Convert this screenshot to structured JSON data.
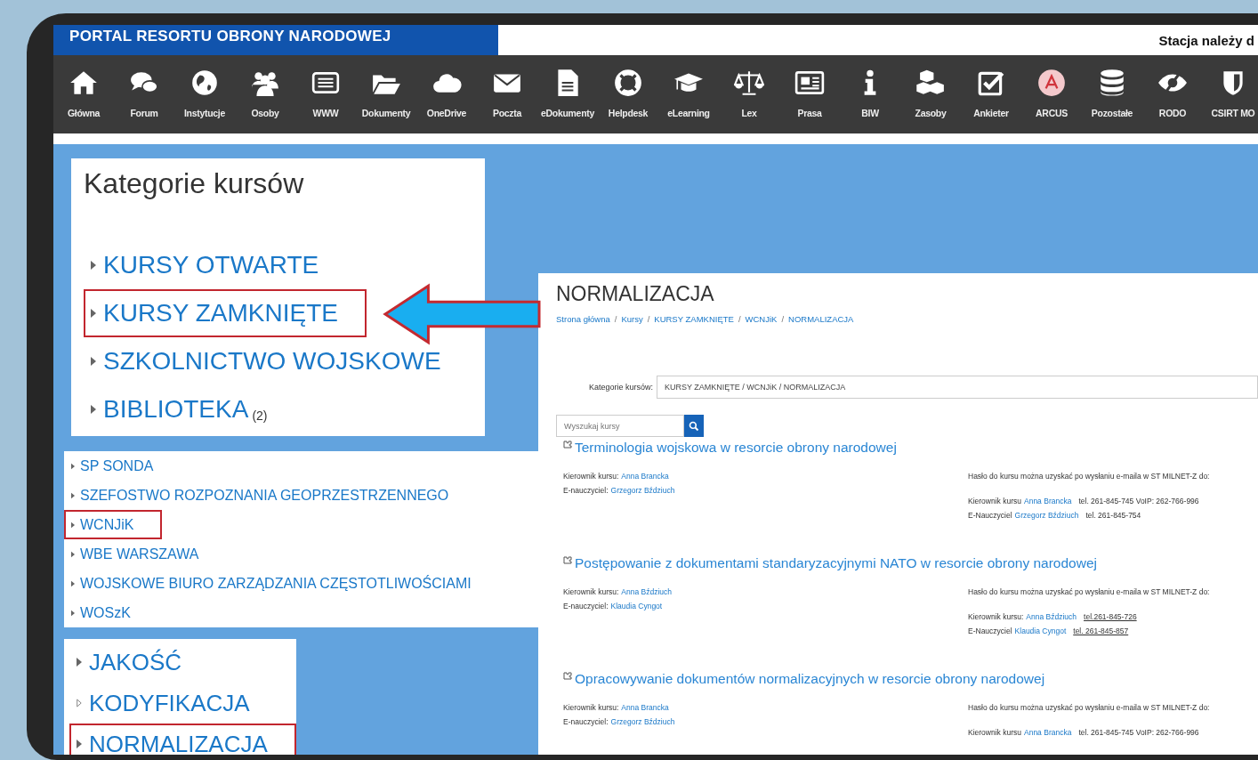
{
  "header": {
    "title": "PORTAL RESORTU OBRONY NARODOWEJ",
    "notice": "Stacja należy d"
  },
  "toolbar": [
    {
      "label": "Główna"
    },
    {
      "label": "Forum"
    },
    {
      "label": "Instytucje"
    },
    {
      "label": "Osoby"
    },
    {
      "label": "WWW"
    },
    {
      "label": "Dokumenty"
    },
    {
      "label": "OneDrive"
    },
    {
      "label": "Poczta"
    },
    {
      "label": "eDokumenty"
    },
    {
      "label": "Helpdesk"
    },
    {
      "label": "eLearning"
    },
    {
      "label": "Lex"
    },
    {
      "label": "Prasa"
    },
    {
      "label": "BIW"
    },
    {
      "label": "Zasoby"
    },
    {
      "label": "Ankieter"
    },
    {
      "label": "ARCUS"
    },
    {
      "label": "Pozostałe"
    },
    {
      "label": "RODO"
    },
    {
      "label": "CSIRT MO"
    }
  ],
  "categories_panel": {
    "title": "Kategorie kursów",
    "items": [
      {
        "label": "KURSY OTWARTE",
        "highlighted": false
      },
      {
        "label": "KURSY ZAMKNIĘTE",
        "highlighted": true
      },
      {
        "label": "SZKOLNICTWO WOJSKOWE",
        "highlighted": false
      },
      {
        "label": "BIBLIOTEKA",
        "count": "(2)",
        "highlighted": false
      }
    ]
  },
  "subcategories": [
    {
      "label": "SP SONDA",
      "highlighted": false
    },
    {
      "label": "SZEFOSTWO ROZPOZNANIA GEOPRZESTRZENNEGO",
      "highlighted": false
    },
    {
      "label": "WCNJiK",
      "highlighted": true
    },
    {
      "label": "WBE WARSZAWA",
      "highlighted": false
    },
    {
      "label": "WOJSKOWE BIURO ZARZĄDZANIA CZĘSTOTLIWOŚCIAMI",
      "highlighted": false
    },
    {
      "label": "WOSzK",
      "highlighted": false
    }
  ],
  "sections": [
    {
      "label": "JAKOŚĆ",
      "kind": "filled",
      "highlighted": false
    },
    {
      "label": "KODYFIKACJA",
      "kind": "hollow",
      "highlighted": false
    },
    {
      "label": "NORMALIZACJA",
      "kind": "filled",
      "highlighted": true
    }
  ],
  "page": {
    "title": "NORMALIZACJA",
    "breadcrumb_separator": "/",
    "breadcrumb": [
      "Strona główna",
      "Kursy",
      "KURSY ZAMKNIĘTE",
      "WCNJiK",
      "NORMALIZACJA"
    ],
    "category_label": "Kategorie kursów:",
    "category_value": "KURSY ZAMKNIĘTE / WCNJiK / NORMALIZACJA",
    "search": {
      "placeholder": "Wyszukaj kursy"
    },
    "courses": [
      {
        "title": "Terminologia wojskowa w resorcie obrony narodowej",
        "left": [
          {
            "label": "Kierownik kursu:",
            "person": "Anna Brancka"
          },
          {
            "label": "E-nauczyciel:",
            "person": "Grzegorz Bździuch"
          }
        ],
        "note": "Hasło do kursu można uzyskać po wysłaniu e-maila w ST MILNET-Z do:",
        "right": [
          {
            "label": "Kierownik kursu",
            "person": "Anna Brancka",
            "phone": "tel. 261-845-745 VoIP: 262-766-996",
            "underlined": false
          },
          {
            "label": "E-Nauczyciel",
            "person": "Grzegorz Bździuch",
            "phone": "tel. 261-845-754",
            "underlined": false
          }
        ]
      },
      {
        "title": "Postępowanie z dokumentami standaryzacyjnymi NATO w resorcie obrony narodowej",
        "left": [
          {
            "label": "Kierownik kursu:",
            "person": "Anna Bździuch"
          },
          {
            "label": "E-nauczyciel:",
            "person": "Klaudia Cyngot"
          }
        ],
        "note": "Hasło do kursu można uzyskać po wysłaniu e-maila w ST MILNET-Z do:",
        "right": [
          {
            "label": "Kierownik kursu:",
            "person": "Anna Bździuch",
            "phone": "tel.261-845-726",
            "underlined": true
          },
          {
            "label": "E-Nauczyciel",
            "person": "Klaudia Cyngot",
            "phone": "tel. 261-845-857",
            "underlined": true
          }
        ]
      },
      {
        "title": "Opracowywanie dokumentów normalizacyjnych w resorcie obrony narodowej",
        "left": [
          {
            "label": "Kierownik kursu:",
            "person": "Anna Brancka"
          },
          {
            "label": "E-nauczyciel:",
            "person": "Grzegorz Bździuch"
          }
        ],
        "note": "Hasło do kursu można uzyskać po wysłaniu e-maila w ST MILNET-Z do:",
        "right": [
          {
            "label": "Kierownik kursu",
            "person": "Anna Brancka",
            "phone": "tel. 261-845-745 VoIP: 262-766-996",
            "underlined": false
          }
        ]
      }
    ]
  }
}
